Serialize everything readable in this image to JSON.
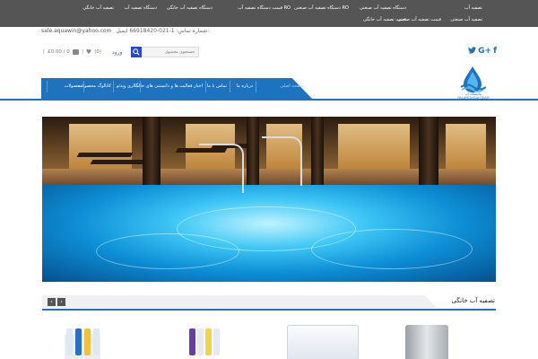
{
  "topbar": {
    "row1": [
      "تصفیه آب",
      "دستگاه تصفیه آب صنعتی",
      "RO دستگاه تصفیه آب صنعتی",
      "RO قیمت دستگاه تصفیه آب",
      "دستگاه تصفیه آب خانگی",
      "دستگاه تصفیه آب",
      "تصفیه آب خانگی"
    ],
    "row2": [
      "تصفیه آب صنعتی",
      "قیمت تصفیه آب صنعتی",
      "قیمت تصفیه آب خانگی"
    ]
  },
  "contact": {
    "email": "sale.aquawin@yahoo.com",
    "phone": "شماره تماس: 1-021-66918420 ایمیل:"
  },
  "header": {
    "cart_text": "£0.00 / 0",
    "wishlist_count": "(0)",
    "login": "ورود",
    "search_placeholder": "جستجوی محصول"
  },
  "logo": {
    "text_fa": "پالایشگاه آب",
    "text_en": "PALAYESHGAH SIAM"
  },
  "nav": {
    "items": [
      "صفحه اصلی",
      "درباره ما",
      "تماس با ما",
      "اخبار فعالیت ها و دانستنی های جالب",
      "گالری ویدئو",
      "کاتالوگ محصولات",
      "محصولات"
    ]
  },
  "section": {
    "title": "تصفیه آب خانگی",
    "prev": "‹",
    "next": "›"
  },
  "icons": {
    "facebook": "f",
    "google_plus": "G+",
    "twitter": "🐦"
  },
  "colors": {
    "brand_blue": "#1e73be",
    "topbar": "#555555",
    "search_button": "#2a49c8"
  }
}
